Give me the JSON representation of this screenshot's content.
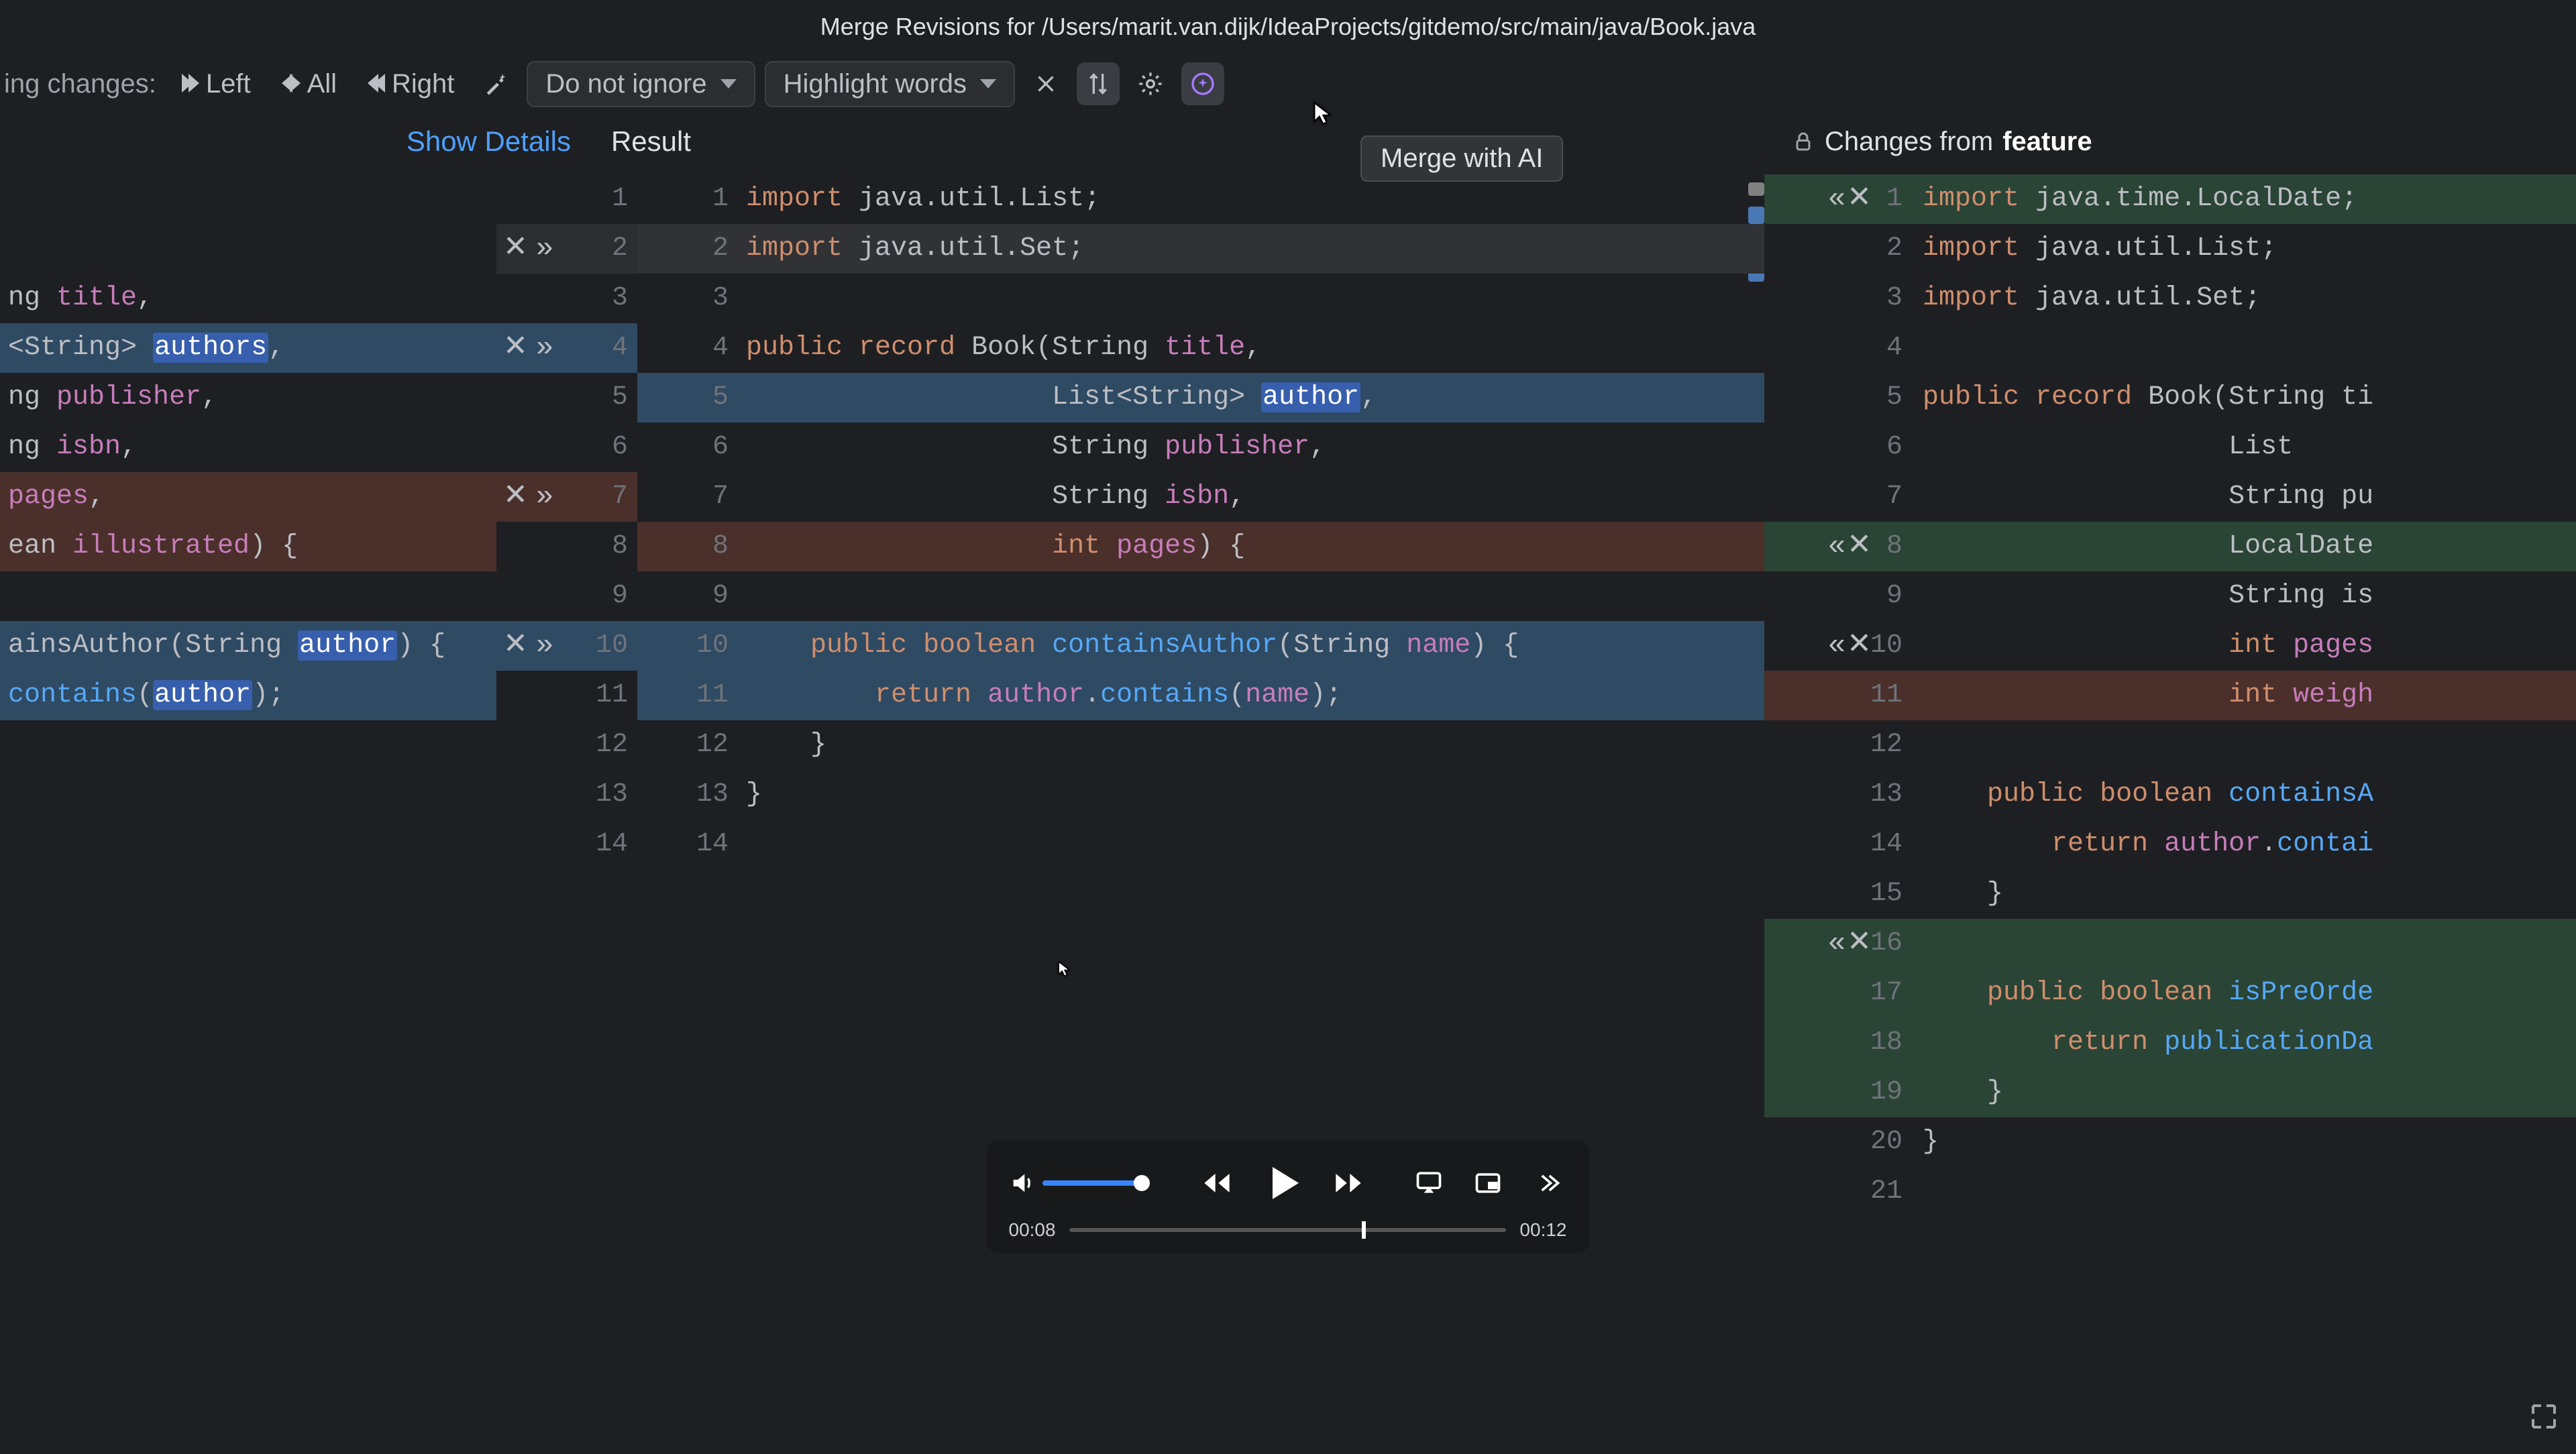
{
  "title": "Merge Revisions for /Users/marit.van.dijk/IdeaProjects/gitdemo/src/main/java/Book.java",
  "toolbar": {
    "pending": "ing changes:",
    "left": "Left",
    "all": "All",
    "right": "Right",
    "ignore": "Do not ignore",
    "highlight": "Highlight words"
  },
  "subheader": {
    "details": "Show Details",
    "result": "Result",
    "changes_from": "Changes from ",
    "branch": "feature"
  },
  "tooltip": "Merge with AI",
  "left_lines": [
    "",
    "",
    "ng title,",
    "<String> authors,",
    "ng publisher,",
    "ng isbn,",
    "pages,",
    "ean illustrated) {",
    "",
    "ainsAuthor(String author) {",
    "contains(author);",
    "",
    "",
    ""
  ],
  "left_nums": [
    "1",
    "2",
    "3",
    "4",
    "5",
    "6",
    "7",
    "8",
    "9",
    "10",
    "11",
    "12",
    "13",
    "14"
  ],
  "mid_nums": [
    "1",
    "2",
    "3",
    "4",
    "5",
    "6",
    "7",
    "8",
    "9",
    "10",
    "11",
    "12",
    "13",
    "14"
  ],
  "mid_lines": [
    {
      "t": "import java.util.List;",
      "cls": ""
    },
    {
      "t": "import java.util.Set;",
      "cls": "bg-dim2"
    },
    {
      "t": "",
      "cls": ""
    },
    {
      "t": "public record Book(String title,",
      "cls": ""
    },
    {
      "t": "                   List<String> author,",
      "cls": "bg-mod"
    },
    {
      "t": "                   String publisher,",
      "cls": ""
    },
    {
      "t": "                   String isbn,",
      "cls": ""
    },
    {
      "t": "                   int pages) {",
      "cls": "bg-del"
    },
    {
      "t": "",
      "cls": ""
    },
    {
      "t": "    public boolean containsAuthor(String name) {",
      "cls": "bg-mod"
    },
    {
      "t": "        return author.contains(name);",
      "cls": "bg-mod"
    },
    {
      "t": "    }",
      "cls": ""
    },
    {
      "t": "}",
      "cls": ""
    },
    {
      "t": "",
      "cls": ""
    }
  ],
  "right_nums": [
    "1",
    "2",
    "3",
    "4",
    "5",
    "6",
    "7",
    "8",
    "9",
    "10",
    "11",
    "12",
    "13",
    "14",
    "15",
    "16",
    "17",
    "18",
    "19",
    "20",
    "21"
  ],
  "right_lines": [
    {
      "t": "import java.time.LocalDate;",
      "cls": "bg-add"
    },
    {
      "t": "import java.util.List;",
      "cls": ""
    },
    {
      "t": "import java.util.Set;",
      "cls": ""
    },
    {
      "t": "",
      "cls": ""
    },
    {
      "t": "public record Book(String ti",
      "cls": ""
    },
    {
      "t": "                   List<Stri",
      "cls": ""
    },
    {
      "t": "                   String pu",
      "cls": ""
    },
    {
      "t": "                   LocalDate",
      "cls": "bg-add"
    },
    {
      "t": "                   String is",
      "cls": ""
    },
    {
      "t": "                   int pages",
      "cls": ""
    },
    {
      "t": "                   int weigh",
      "cls": "bg-del"
    },
    {
      "t": "",
      "cls": ""
    },
    {
      "t": "    public boolean containsA",
      "cls": ""
    },
    {
      "t": "        return author.contai",
      "cls": ""
    },
    {
      "t": "    }",
      "cls": ""
    },
    {
      "t": "",
      "cls": "bg-add"
    },
    {
      "t": "    public boolean isPreOrde",
      "cls": "bg-add"
    },
    {
      "t": "        return publicationDa",
      "cls": "bg-add"
    },
    {
      "t": "    }",
      "cls": "bg-add"
    },
    {
      "t": "}",
      "cls": ""
    },
    {
      "t": "",
      "cls": ""
    }
  ],
  "left_actions": [
    2,
    4,
    7,
    10
  ],
  "right_actions": [
    1,
    8,
    10,
    16
  ],
  "player": {
    "cur": "00:08",
    "dur": "00:12",
    "seek_pct": 67
  }
}
